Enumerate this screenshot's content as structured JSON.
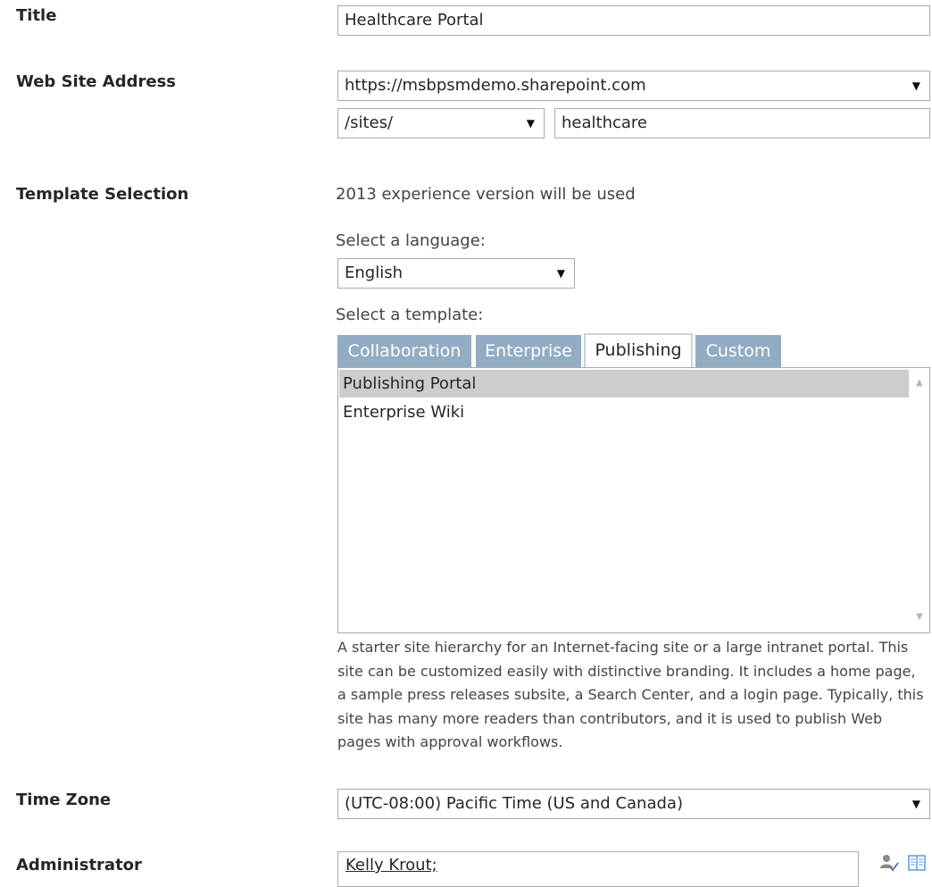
{
  "title_row": {
    "label": "Title",
    "value": "Healthcare Portal"
  },
  "address_row": {
    "label": "Web Site Address",
    "domain": "https://msbpsmdemo.sharepoint.com",
    "path": "/sites/",
    "url_name": "healthcare"
  },
  "template_row": {
    "label": "Template Selection",
    "experience_note": "2013 experience version will be used",
    "language_label": "Select a language:",
    "language_value": "English",
    "template_label": "Select a template:",
    "tabs": [
      {
        "label": "Collaboration",
        "active": false
      },
      {
        "label": "Enterprise",
        "active": false
      },
      {
        "label": "Publishing",
        "active": true
      },
      {
        "label": "Custom",
        "active": false
      }
    ],
    "templates": [
      {
        "label": "Publishing Portal",
        "selected": true
      },
      {
        "label": "Enterprise Wiki",
        "selected": false
      }
    ],
    "description": "A starter site hierarchy for an Internet-facing site or a large intranet portal. This site can be customized easily with distinctive branding. It includes a home page, a sample press releases subsite, a Search Center, and a login page. Typically, this site has many more readers than contributors, and it is used to publish Web pages with approval workflows."
  },
  "timezone_row": {
    "label": "Time Zone",
    "value": "(UTC-08:00) Pacific Time (US and Canada)"
  },
  "admin_row": {
    "label": "Administrator",
    "value": "Kelly Krout;"
  },
  "icons": {
    "dropdown": "triangle-down-icon",
    "check_names": "check-names-icon",
    "browse": "address-book-icon",
    "scroll_up": "scroll-up-icon",
    "scroll_down": "scroll-down-icon"
  },
  "colors": {
    "tab_inactive": "#92acc3",
    "selected_row": "#cdcdcd",
    "border": "#ababab"
  }
}
